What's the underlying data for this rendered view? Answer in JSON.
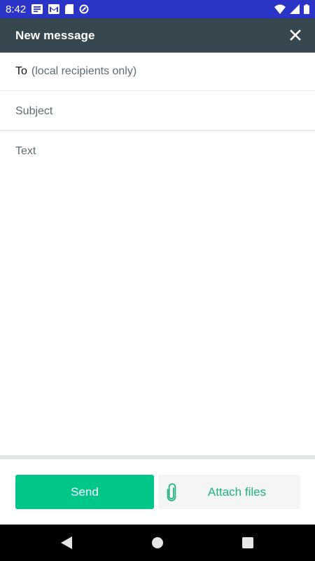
{
  "status_bar": {
    "time": "8:42",
    "background": "#2c34c8",
    "left_icons": [
      "news-icon",
      "gmail-icon",
      "sd-card-icon",
      "sync-icon"
    ],
    "right_icons": [
      "wifi-icon",
      "signal-icon",
      "battery-icon"
    ]
  },
  "app_bar": {
    "title": "New message",
    "background": "#37474f",
    "close_icon": "close-icon"
  },
  "compose": {
    "to_label": "To",
    "to_placeholder": "(local recipients only)",
    "subject_placeholder": "Subject",
    "text_placeholder": "Text"
  },
  "actions": {
    "send_label": "Send",
    "send_color": "#00c68a",
    "attach_label": "Attach files",
    "attach_color": "#1fb47c",
    "attach_icon": "paperclip-icon"
  },
  "nav_bar": {
    "buttons": [
      "back-icon",
      "home-icon",
      "recents-icon"
    ]
  }
}
